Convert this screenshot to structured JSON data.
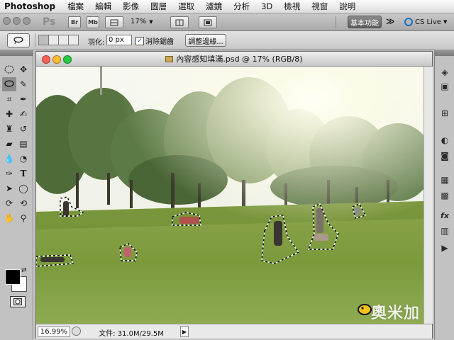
{
  "menubar": {
    "app": "Photoshop",
    "items": [
      "檔案",
      "編輯",
      "影像",
      "圖層",
      "選取",
      "濾鏡",
      "分析",
      "3D",
      "檢視",
      "視窗",
      "說明"
    ]
  },
  "appbar": {
    "logo": "Ps",
    "bridge": "Br",
    "minibridge": "Mb",
    "zoom": "17%",
    "workspace": "基本功能",
    "more": "≫",
    "cslive": "CS Live"
  },
  "options": {
    "feather_label": "羽化:",
    "feather_value": "0 px",
    "antialias_label": "消除鋸齒",
    "refine_edge": "調整邊緣..."
  },
  "document": {
    "title": "內容感知填滿.psd @ 17% (RGB/8)",
    "zoom": "16.99%",
    "file_size": "文件: 31.0M/29.5M"
  },
  "watermark": "奧米加",
  "colors": {
    "close": "#ff5f57",
    "minimize": "#febc2e",
    "zoom": "#28c840"
  }
}
